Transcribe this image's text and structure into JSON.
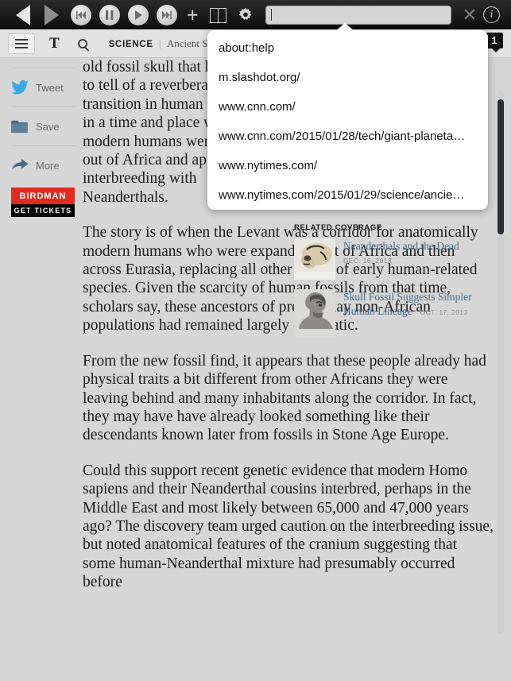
{
  "browser": {
    "toolbar": {
      "back_icon": "back-triangle-icon",
      "forward_icon": "forward-triangle-icon",
      "rewind_icon": "rewind-icon",
      "pause_icon": "pause-icon",
      "play_icon": "play-icon",
      "fastforward_icon": "fast-forward-icon",
      "add_icon": "plus-icon",
      "reader_icon": "book-icon",
      "settings_icon": "gear-icon",
      "close_icon": "close-x-icon",
      "info_icon": "info-circle-icon"
    },
    "address_bar": {
      "value": "",
      "placeholder": ""
    }
  },
  "suggestions": {
    "items": [
      {
        "label": "about:help"
      },
      {
        "label": "m.slashdot.org/"
      },
      {
        "label": "www.cnn.com/"
      },
      {
        "label": "www.cnn.com/2015/01/28/tech/giant-planeta…"
      },
      {
        "label": "www.nytimes.com/"
      },
      {
        "label": "www.nytimes.com/2015/01/29/science/ancie…"
      }
    ]
  },
  "site_header": {
    "menu_icon": "hamburger-menu-icon",
    "logo": "T",
    "search_icon": "search-icon",
    "section": "SCIENCE",
    "divider": "|",
    "headline_snippet": "Ancient Sku",
    "tab_count": "1"
  },
  "share_rail": {
    "items": [
      {
        "label": "Tweet",
        "icon": "twitter-bird-icon"
      },
      {
        "label": "Save",
        "icon": "folder-icon"
      },
      {
        "label": "More",
        "icon": "share-arrow-icon"
      }
    ],
    "ad": {
      "title": "BIRDMAN",
      "subtitle": "GET TICKETS",
      "brand_color": "#e02b1d"
    }
  },
  "article": {
    "paragraphs": [
      "old fossil skull that has a story to tell of a reverberating transition in human evolution, in a time and place when some modern humans were moving out of Africa and apparently interbreeding with Neanderthals.",
      "The story is of when the Levant was a corridor for anatomically modern humans who were expanding out of Africa and then across Eurasia, replacing all other forms of early human-related species. Given the scarcity of human fossils from that time, scholars say, these ancestors of present-day non-African populations had remained largely enigmatic.",
      "From the new fossil find, it appears that these people already had physical traits a bit different from other Africans they were leaving behind and many inhabitants along the corridor. In fact, they may have have already looked something like their descendants known later from fossils in Stone Age Europe.",
      "Could this support recent genetic evidence that modern Homo sapiens and their Neanderthal cousins interbred, perhaps in the Middle East and most likely between 65,000 and 47,000 years ago? The discovery team urged caution on the interbreeding issue, but noted anatomical features of the cranium suggesting that some human-Neanderthal mixture had presumably occurred before"
    ]
  },
  "related_coverage": {
    "heading": "RELATED COVERAGE",
    "items": [
      {
        "title": "Neanderthals and the Dead",
        "date": "DEC. 16, 2013",
        "thumb": "skull-photo"
      },
      {
        "title": "Skull Fossil Suggests Simpler Human Lineage",
        "date": "OCT. 17, 2013",
        "thumb": "hominid-illustration"
      }
    ]
  },
  "overflow_dots": "····"
}
